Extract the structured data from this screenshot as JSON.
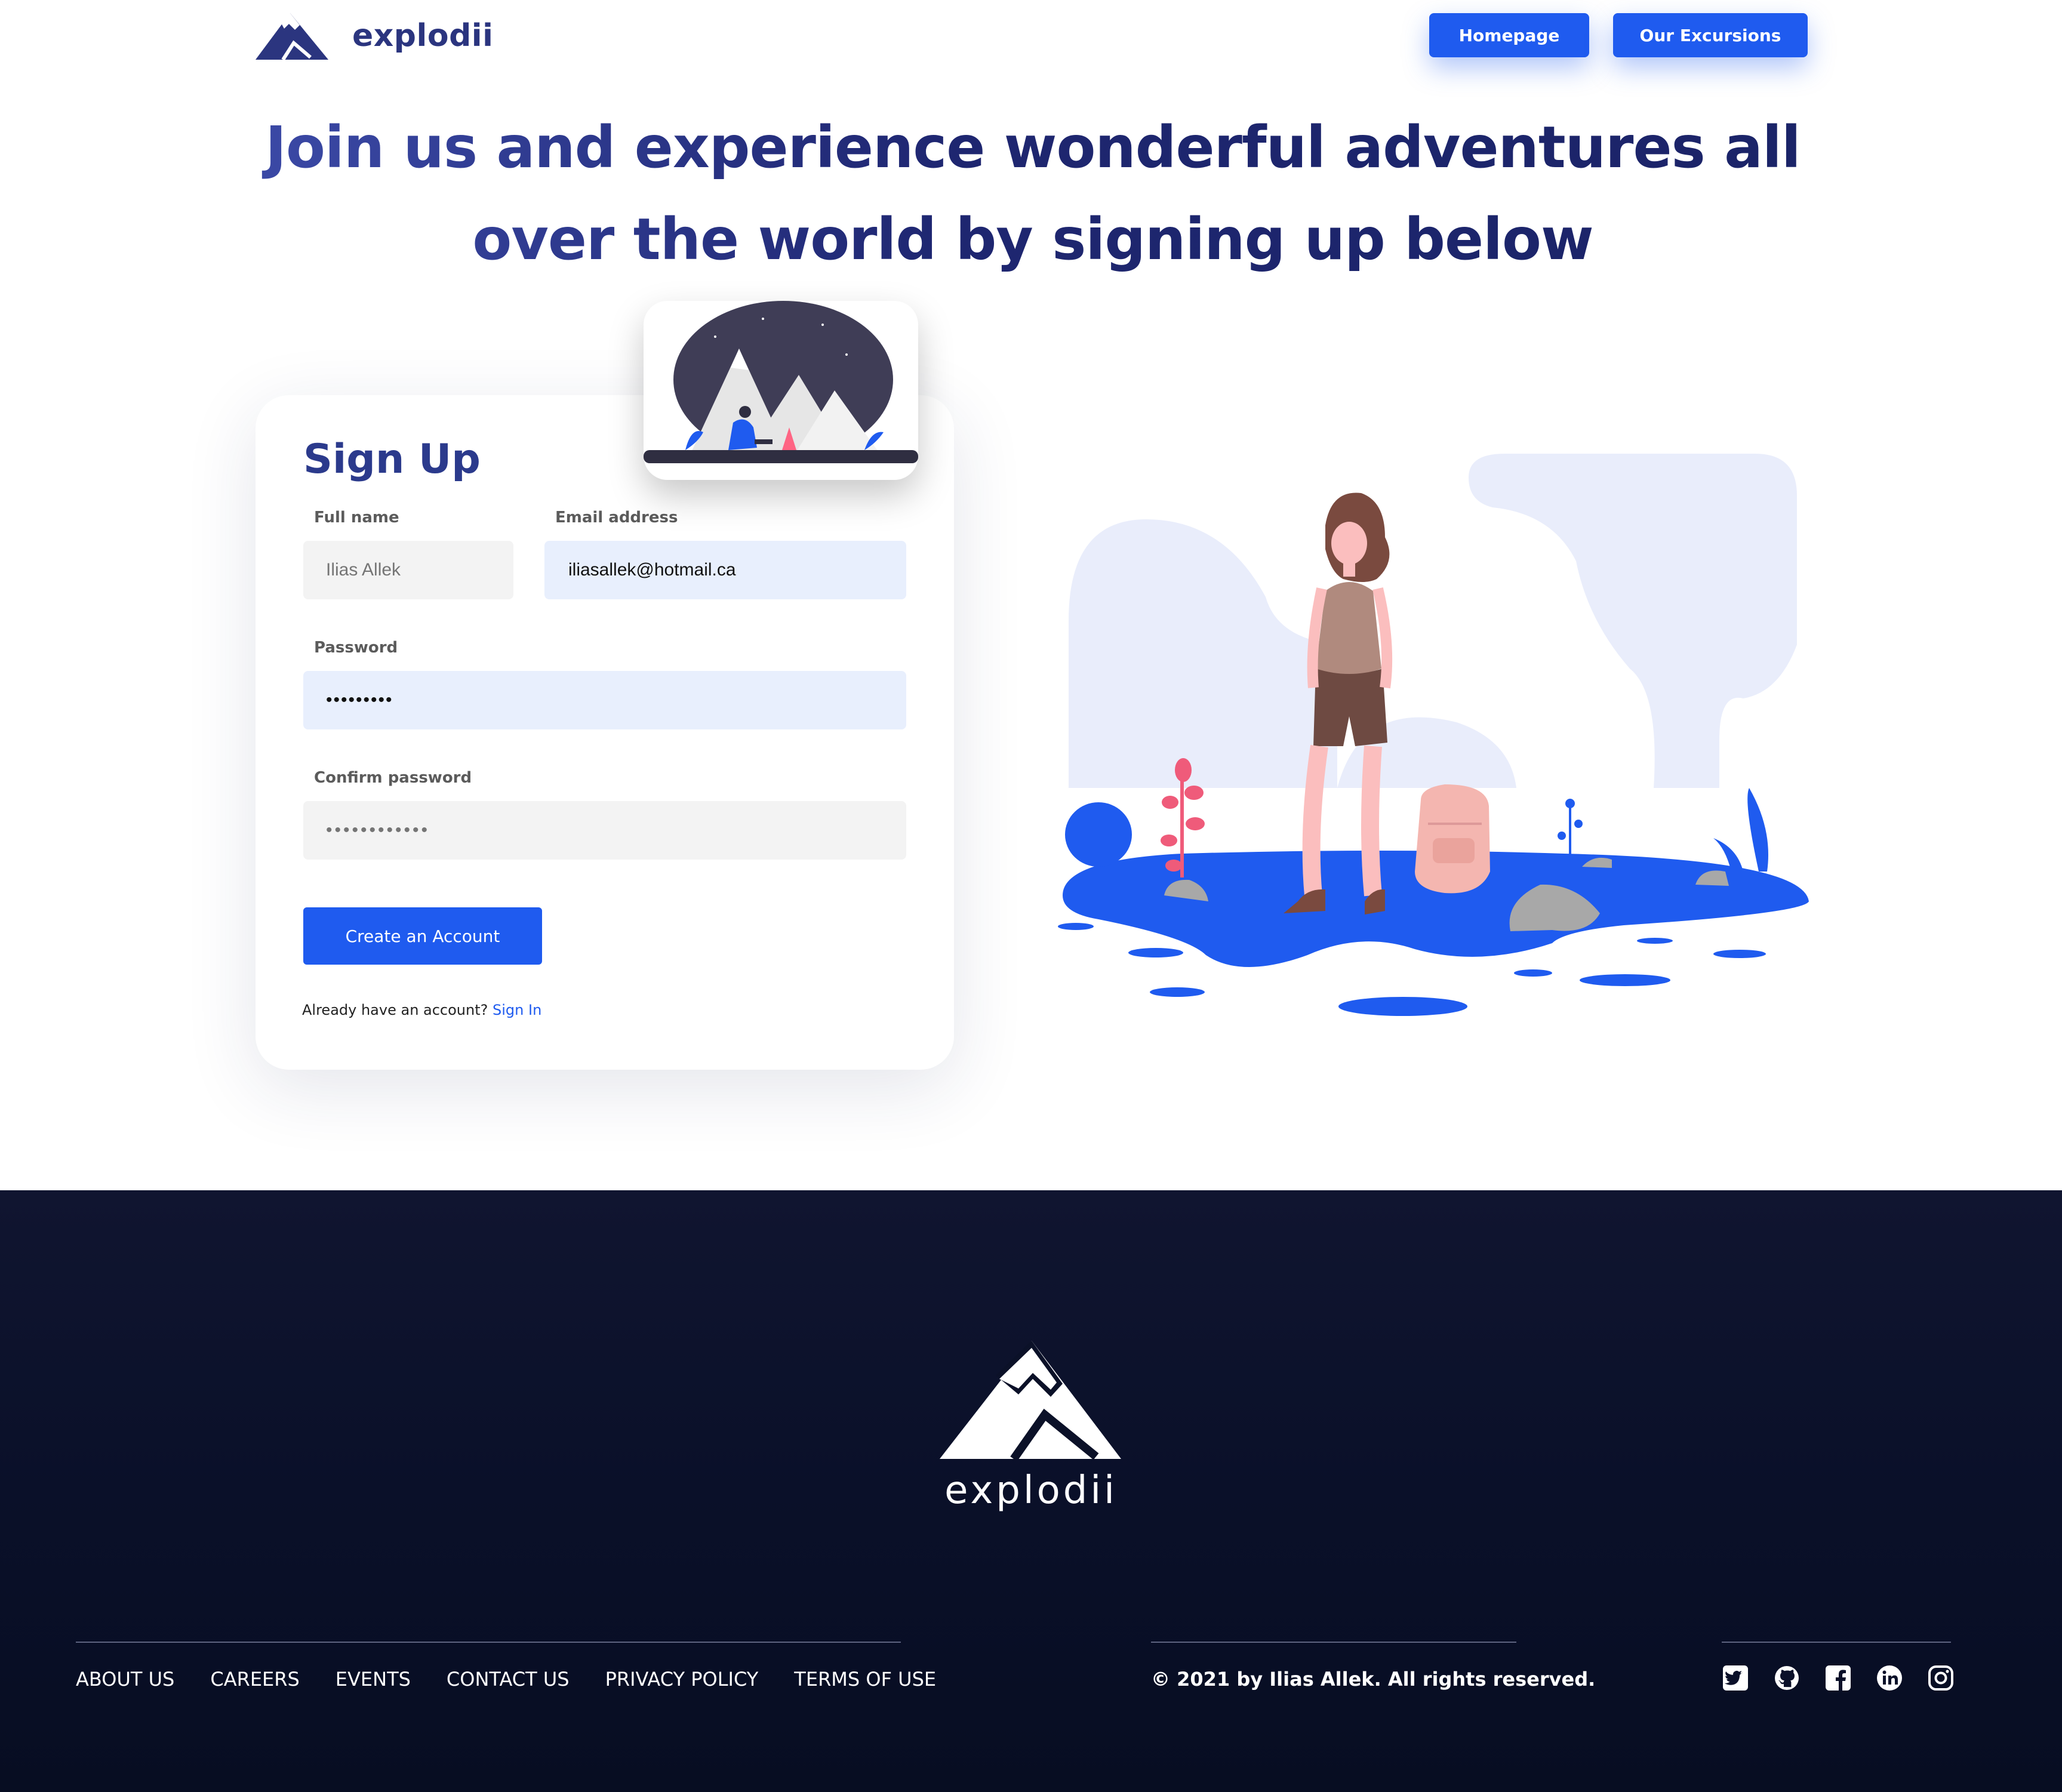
{
  "header": {
    "brand": "explodii",
    "nav": {
      "homepage": "Homepage",
      "excursions": "Our Excursions"
    }
  },
  "hero": {
    "headline_line1": "Join us and experience wonderful adventures all",
    "headline_line2": "over the world by signing up below"
  },
  "signup": {
    "title": "Sign Up",
    "full_name": {
      "label": "Full name",
      "placeholder": "Ilias Allek",
      "value": ""
    },
    "email": {
      "label": "Email address",
      "value": "iliasallek@hotmail.ca"
    },
    "password": {
      "label": "Password",
      "value": "•••••••••"
    },
    "confirm_password": {
      "label": "Confirm password",
      "placeholder": "••••••••••••",
      "value": ""
    },
    "submit": "Create an Account",
    "signin_prompt": "Already have an account?",
    "signin_link": "Sign In"
  },
  "footer": {
    "brand": "explodii",
    "links": [
      "ABOUT US",
      "CAREERS",
      "EVENTS",
      "CONTACT US",
      "PRIVACY POLICY",
      "TERMS OF USE"
    ],
    "copyright": "© 2021 by Ilias Allek. All rights reserved.",
    "socials": [
      "twitter-icon",
      "github-icon",
      "facebook-icon",
      "linkedin-icon",
      "instagram-icon"
    ]
  },
  "colors": {
    "accent": "#1f5bef",
    "heading": "#2b3a8c",
    "footer_bg": "#0a1029",
    "input_active": "#e8effd",
    "input_idle": "#f3f3f3"
  }
}
